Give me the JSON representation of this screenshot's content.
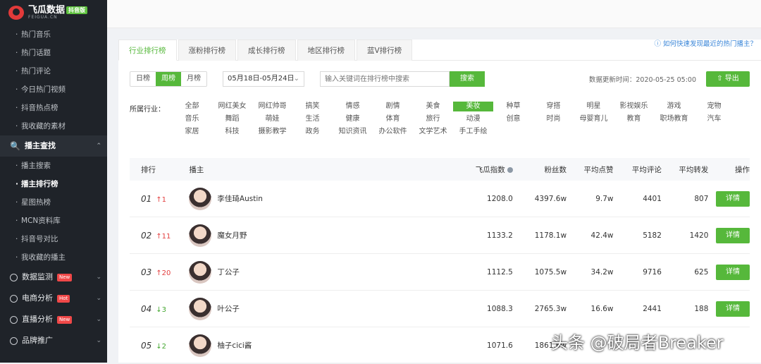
{
  "brand": {
    "name": "飞瓜数据",
    "sub": "FEIGUA.CN",
    "badge": "抖音版"
  },
  "sidebar": {
    "sub_items_1": [
      {
        "label": "热门音乐"
      },
      {
        "label": "热门话题"
      },
      {
        "label": "热门评论"
      },
      {
        "label": "今日热门视频"
      },
      {
        "label": "抖音热点榜"
      },
      {
        "label": "我收藏的素材"
      }
    ],
    "group_open": "播主查找",
    "sub_items_2": [
      {
        "label": "播主搜索"
      },
      {
        "label": "播主排行榜"
      },
      {
        "label": "星图热榜"
      },
      {
        "label": "MCN资料库"
      },
      {
        "label": "抖音号对比"
      },
      {
        "label": "我收藏的播主"
      }
    ],
    "groups": [
      {
        "label": "数据监测",
        "badge": "New"
      },
      {
        "label": "电商分析",
        "badge": "Hot"
      },
      {
        "label": "直播分析",
        "badge": "New"
      },
      {
        "label": "品牌推广",
        "badge": ""
      }
    ]
  },
  "tabs": [
    "行业排行榜",
    "涨粉排行榜",
    "成长排行榜",
    "地区排行榜",
    "蓝V排行榜"
  ],
  "help_link": "如何快速发现最近的热门播主？",
  "period": [
    "日榜",
    "周榜",
    "月榜"
  ],
  "date_range": "05月18日-05月24日",
  "search": {
    "placeholder": "输入关键词在排行榜中搜索",
    "button": "搜索"
  },
  "updated": "数据更新时间：2020-05-25 05:00",
  "export": "导出",
  "industry_label": "所属行业：",
  "industries": [
    "全部",
    "网红美女",
    "网红帅哥",
    "搞笑",
    "情感",
    "剧情",
    "美食",
    "美妆",
    "种草",
    "穿搭",
    "明星",
    "影视娱乐",
    "游戏",
    "宠物",
    "音乐",
    "舞蹈",
    "萌娃",
    "生活",
    "健康",
    "体育",
    "旅行",
    "动漫",
    "创意",
    "时尚",
    "母婴育儿",
    "教育",
    "职场教育",
    "汽车",
    "家居",
    "科技",
    "摄影教学",
    "政务",
    "知识资讯",
    "办公软件",
    "文学艺术",
    "手工手绘"
  ],
  "active_industry": "美妆",
  "table": {
    "headers": {
      "rank": "排行",
      "name": "播主",
      "index": "飞瓜指数",
      "fans": "粉丝数",
      "likes": "平均点赞",
      "comments": "平均评论",
      "forwards": "平均转发",
      "op": "操作"
    },
    "rows": [
      {
        "rank": "01",
        "change": "↑1",
        "dir": "up",
        "name": "李佳琦Austin",
        "index": "1208.0",
        "fans": "4397.6w",
        "likes": "9.7w",
        "comments": "4401",
        "forwards": "807",
        "op": "详情"
      },
      {
        "rank": "02",
        "change": "↑11",
        "dir": "up",
        "name": "魔女月野",
        "index": "1133.2",
        "fans": "1178.1w",
        "likes": "42.4w",
        "comments": "5182",
        "forwards": "1420",
        "op": "详情"
      },
      {
        "rank": "03",
        "change": "↑20",
        "dir": "up",
        "name": "丁公子",
        "index": "1112.5",
        "fans": "1075.5w",
        "likes": "34.2w",
        "comments": "9716",
        "forwards": "625",
        "op": "详情"
      },
      {
        "rank": "04",
        "change": "↓3",
        "dir": "down",
        "name": "叶公子",
        "index": "1088.3",
        "fans": "2765.3w",
        "likes": "16.6w",
        "comments": "2441",
        "forwards": "188",
        "op": "详情"
      },
      {
        "rank": "05",
        "change": "↓2",
        "dir": "down",
        "name": "柚子cici酱",
        "index": "1071.6",
        "fans": "1861.6w",
        "likes": "",
        "comments": "",
        "forwards": "",
        "op": ""
      }
    ]
  },
  "watermark": "头条 @破局者Breaker"
}
